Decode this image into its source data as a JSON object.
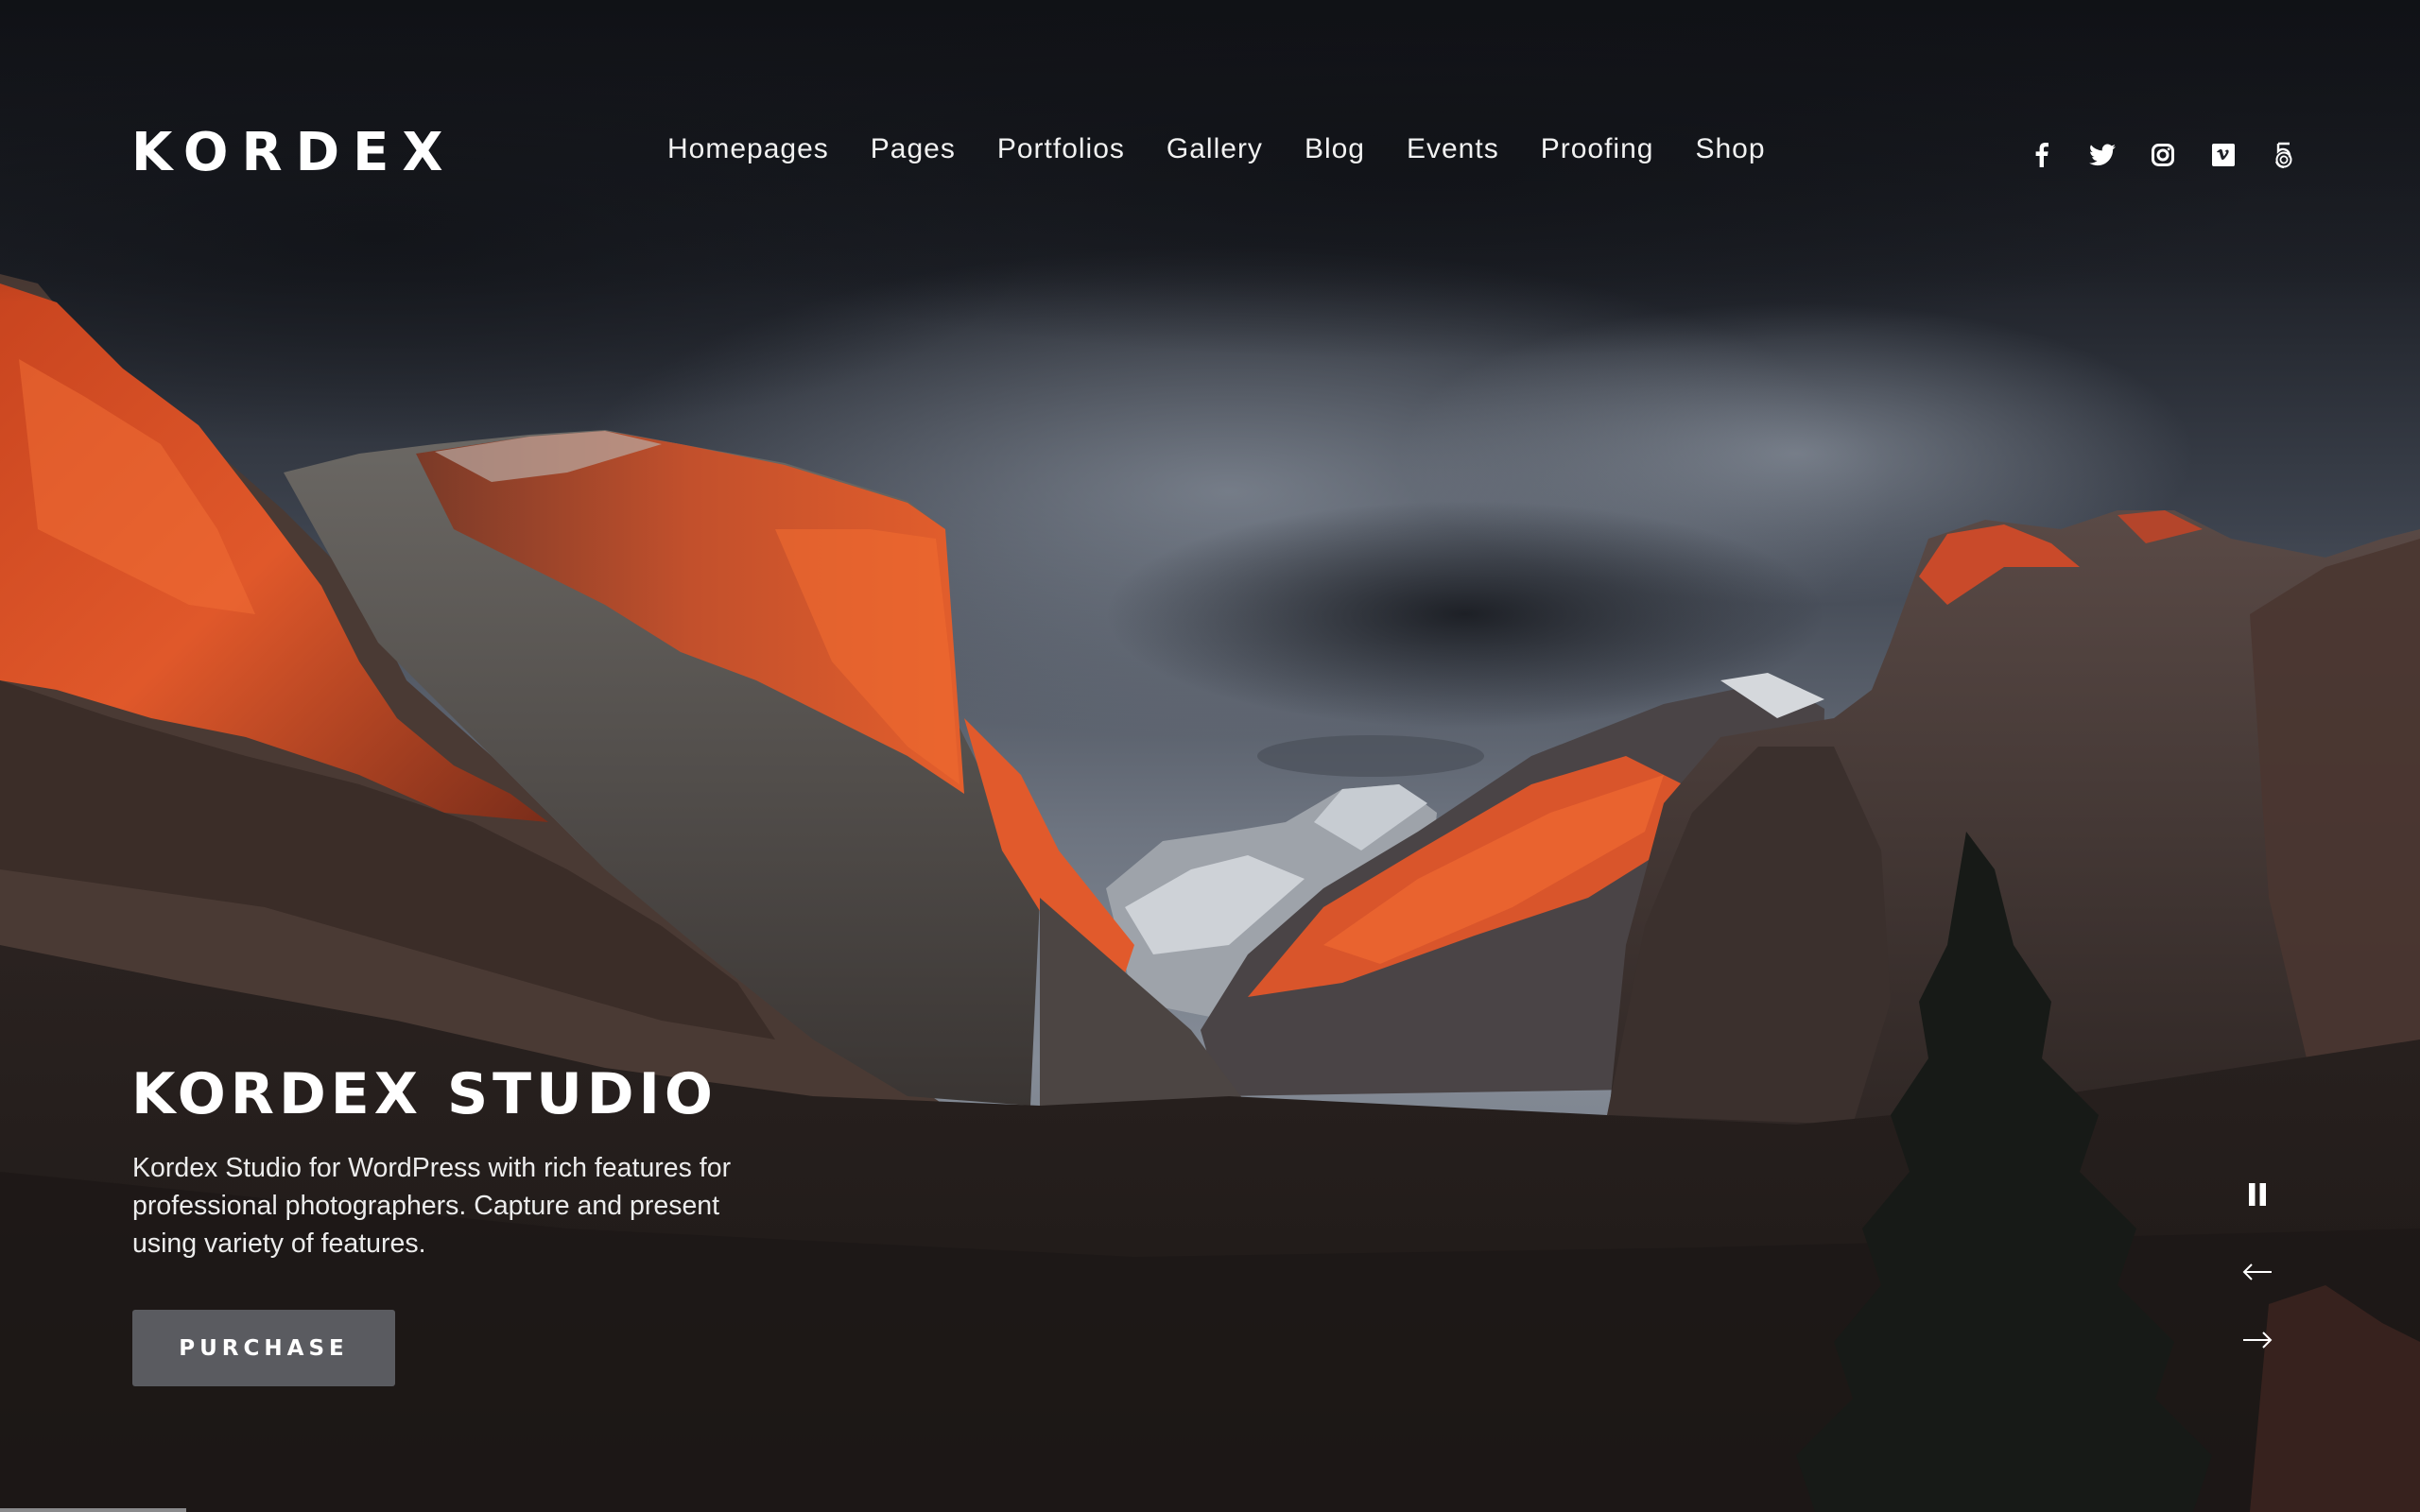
{
  "header": {
    "logo": "KORDEX",
    "nav": [
      {
        "label": "Homepages"
      },
      {
        "label": "Pages"
      },
      {
        "label": "Portfolios"
      },
      {
        "label": "Gallery"
      },
      {
        "label": "Blog"
      },
      {
        "label": "Events"
      },
      {
        "label": "Proofing"
      },
      {
        "label": "Shop"
      }
    ],
    "social": [
      {
        "name": "facebook-icon",
        "label": "Facebook"
      },
      {
        "name": "twitter-icon",
        "label": "Twitter"
      },
      {
        "name": "instagram-icon",
        "label": "Instagram"
      },
      {
        "name": "vimeo-icon",
        "label": "Vimeo"
      },
      {
        "name": "500px-icon",
        "label": "500px"
      }
    ]
  },
  "hero": {
    "title": "KORDEX STUDIO",
    "description": "Kordex Studio for WordPress with rich features for professional photographers. Capture and present using variety of features.",
    "button_label": "PURCHASE",
    "image_subject": "Yosemite valley at sunset with storm clouds"
  },
  "slider": {
    "controls": [
      {
        "name": "pause-icon",
        "label": "Pause"
      },
      {
        "name": "arrow-left-icon",
        "label": "Previous slide"
      },
      {
        "name": "arrow-right-icon",
        "label": "Next slide"
      }
    ],
    "progress_percent": 7.7
  },
  "colors": {
    "text": "#ffffff",
    "button_bg": "#5a5b60",
    "progress": "#8a8a8c",
    "alpenglow": "#e0532a"
  }
}
